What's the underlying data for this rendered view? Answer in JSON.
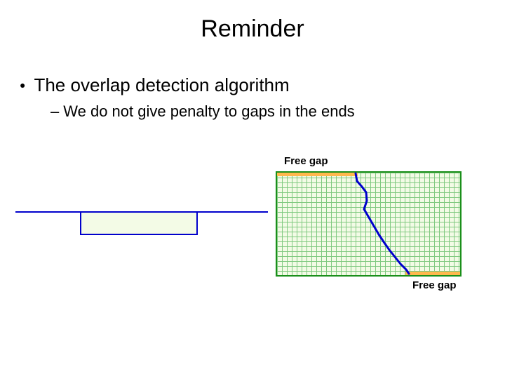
{
  "title": "Reminder",
  "bullet": "The overlap detection algorithm",
  "sub": "We do not give penalty to gaps in the ends",
  "labels": {
    "top": "Free gap",
    "bottom": "Free gap"
  },
  "colors": {
    "blue": "#0000cc",
    "grid_border": "#1a8f1a",
    "grid_fill": "#f3fbe6",
    "free_gap": "#ffb84d"
  }
}
